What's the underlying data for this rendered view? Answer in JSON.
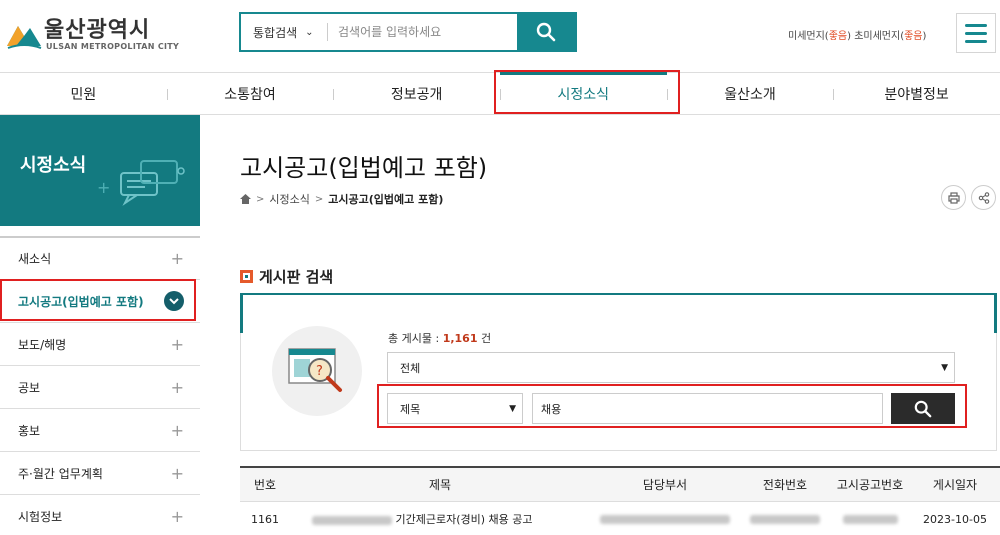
{
  "header": {
    "logo_text": "울산광역시",
    "logo_sub": "ULSAN METROPOLITAN CITY",
    "search_scope": "통합검색",
    "search_placeholder": "검색어를 입력하세요",
    "dust_label1": "미세먼지(",
    "dust_value1": "좋음",
    "dust_label2": ") 초미세먼지(",
    "dust_value2": "좋음",
    "dust_label3": ")",
    "accent": "#16888f"
  },
  "gnb": [
    "민원",
    "소통참여",
    "정보공개",
    "시정소식",
    "울산소개",
    "분야별정보"
  ],
  "gnb_active": "시정소식",
  "sidebar": {
    "title": "시정소식",
    "items": [
      "새소식",
      "고시공고(입법예고 포함)",
      "보도/해명",
      "공보",
      "홍보",
      "주·월간 업무계획",
      "시험정보"
    ],
    "active_index": 1
  },
  "main": {
    "title": "고시공고(입법예고 포함)",
    "breadcrumb": [
      "시정소식",
      "고시공고(입법예고 포함)"
    ],
    "section_title": "게시판 검색",
    "total_label": "총 게시물 : ",
    "total_count": "1,161",
    "total_unit": " 건",
    "category_select": "전체",
    "field_select": "제목",
    "keyword": "채용"
  },
  "table": {
    "headers": [
      "번호",
      "제목",
      "담당부서",
      "전화번호",
      "고시공고번호",
      "게시일자"
    ],
    "rows": [
      {
        "no": "1161",
        "title": "기간제근로자(경비) 채용 공고",
        "date": "2023-10-05"
      }
    ]
  }
}
